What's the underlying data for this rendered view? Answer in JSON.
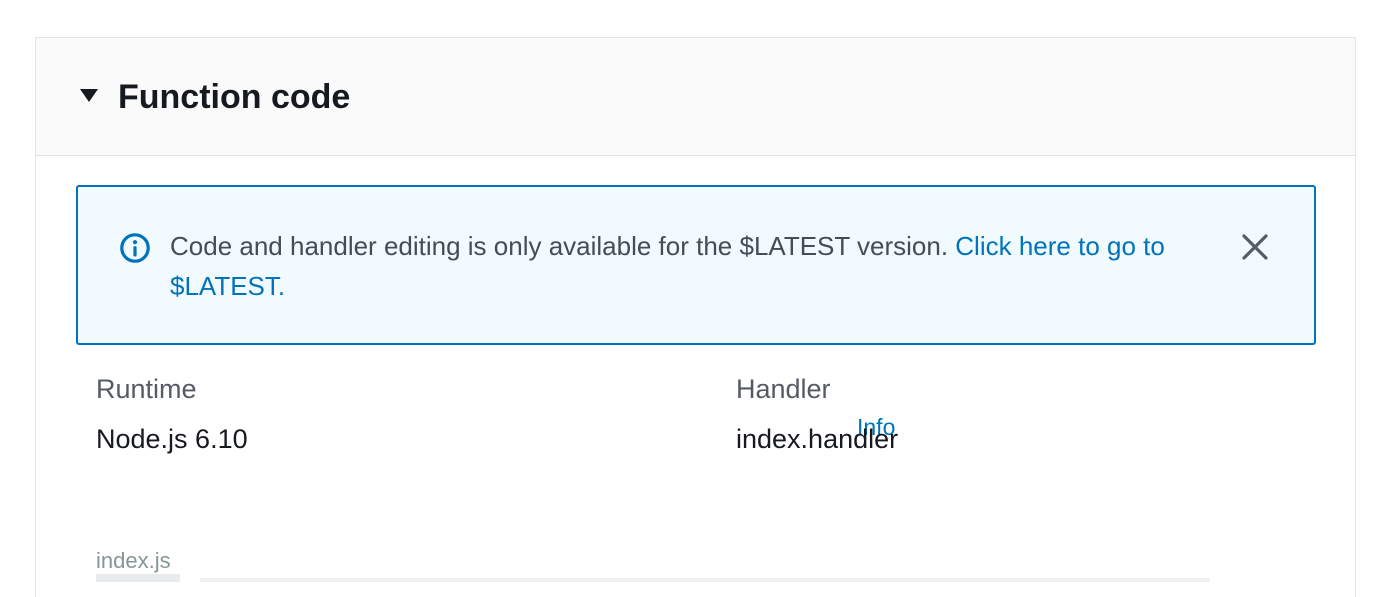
{
  "panel": {
    "title": "Function code"
  },
  "alert": {
    "message": "Code and handler editing is only available for the $LATEST version. ",
    "link_text": "Click here to go to $LATEST."
  },
  "runtime": {
    "label": "Runtime",
    "value": "Node.js 6.10"
  },
  "handler": {
    "label": "Handler",
    "info_link": "Info",
    "value": "index.handler"
  },
  "editor": {
    "file_tab": "index.js"
  },
  "colors": {
    "link": "#0073bb",
    "alert_border": "#0073bb",
    "alert_background": "#f1faff",
    "header_background": "#fafafa"
  },
  "icons": {
    "toggle": "caret-down-icon",
    "alert": "info-icon",
    "dismiss": "close-icon"
  }
}
